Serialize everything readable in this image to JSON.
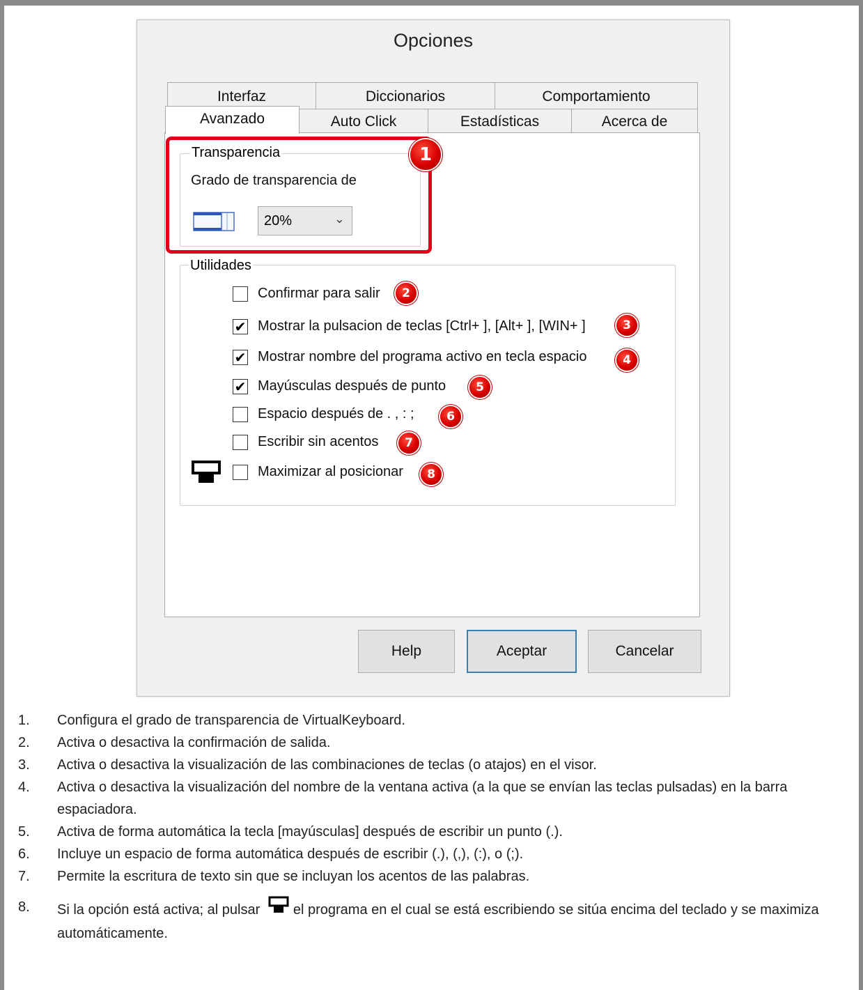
{
  "dialog": {
    "title": "Opciones",
    "tabs_back": [
      "Interfaz",
      "Diccionarios",
      "Comportamiento"
    ],
    "tabs_front": [
      "Avanzado",
      "Auto Click",
      "Estadísticas",
      "Acerca de"
    ],
    "active_tab": "Avanzado"
  },
  "transparency": {
    "group_label": "Transparencia",
    "label": "Grado de transparencia de",
    "select_value": "20%",
    "badge": "1"
  },
  "utilities": {
    "group_label": "Utilidades",
    "items": [
      {
        "label": "Confirmar para salir",
        "checked": false,
        "badge": "2"
      },
      {
        "label": "Mostrar la pulsacion de teclas [Ctrl+ ], [Alt+ ], [WIN+ ]",
        "checked": true,
        "badge": "3"
      },
      {
        "label": "Mostrar nombre del programa activo en tecla espacio",
        "checked": true,
        "badge": "4"
      },
      {
        "label": "Mayúsculas después de punto",
        "checked": true,
        "badge": "5"
      },
      {
        "label": "Espacio después de . , : ;",
        "checked": false,
        "badge": "6"
      },
      {
        "label": "Escribir sin acentos",
        "checked": false,
        "badge": "7"
      },
      {
        "label": "Maximizar al posicionar",
        "checked": false,
        "badge": "8"
      }
    ]
  },
  "buttons": {
    "help": "Help",
    "ok": "Aceptar",
    "cancel": "Cancelar"
  },
  "notes": [
    {
      "num": "1.",
      "text": "Configura el grado de transparencia de VirtualKeyboard."
    },
    {
      "num": "2.",
      "text": "Activa o desactiva la confirmación de salida."
    },
    {
      "num": "3.",
      "text": "Activa o desactiva la visualización de las combinaciones de teclas (o atajos) en el visor."
    },
    {
      "num": "4.",
      "text": "Activa o desactiva la visualización del nombre de la ventana activa (a la que se envían las teclas pulsadas) en la barra espaciadora."
    },
    {
      "num": "5.",
      "text": "Activa de forma automática la tecla [mayúsculas] después de escribir un punto (.)."
    },
    {
      "num": "6.",
      "text": "Incluye un espacio de forma automática después de escribir (.), (,), (:), o (;)."
    },
    {
      "num": "7.",
      "text": "Permite la escritura de texto sin que se incluyan los acentos de las palabras."
    },
    {
      "num": "8.",
      "text_before": "Si la opción está activa; al pulsar",
      "text_after": "el programa en el cual se está escribiendo se sitúa encima del teclado y se maximiza automáticamente."
    }
  ],
  "colors": {
    "highlight": "#e0001a",
    "badge": "#d90000"
  },
  "icons": {
    "transparency": "window-icon",
    "maximize": "monitor-icon"
  }
}
